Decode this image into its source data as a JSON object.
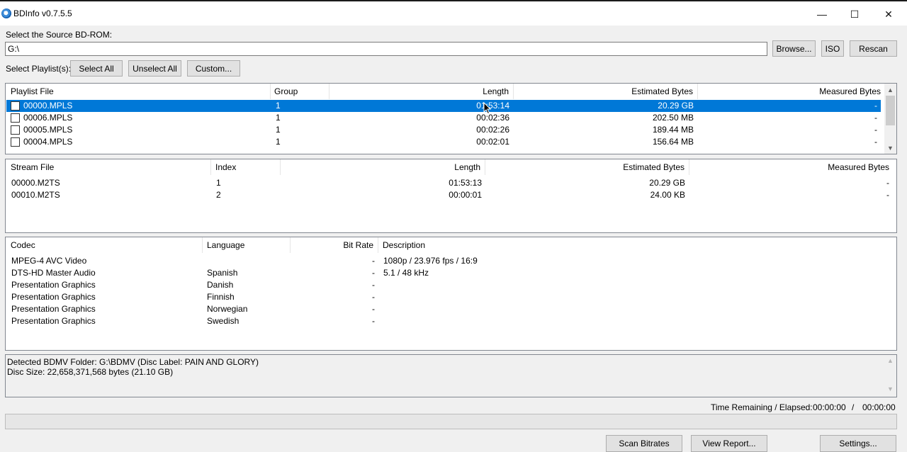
{
  "window": {
    "title": "BDInfo v0.7.5.5",
    "minimize_glyph": "—",
    "maximize_glyph": "☐",
    "close_glyph": "✕"
  },
  "source": {
    "label": "Select the Source BD-ROM:",
    "path": "G:\\",
    "browse_label": "Browse...",
    "iso_label": "ISO",
    "rescan_label": "Rescan"
  },
  "playlist_controls": {
    "label": "Select Playlist(s):",
    "select_all_label": "Select All",
    "unselect_all_label": "Unselect All",
    "custom_label": "Custom..."
  },
  "playlists": {
    "columns": [
      "Playlist File",
      "Group",
      "Length",
      "Estimated Bytes",
      "Measured Bytes"
    ],
    "rows": [
      {
        "file": "00000.MPLS",
        "group": "1",
        "length": "01:53:14",
        "estimated": "20.29 GB",
        "measured": "-"
      },
      {
        "file": "00006.MPLS",
        "group": "1",
        "length": "00:02:36",
        "estimated": "202.50 MB",
        "measured": "-"
      },
      {
        "file": "00005.MPLS",
        "group": "1",
        "length": "00:02:26",
        "estimated": "189.44 MB",
        "measured": "-"
      },
      {
        "file": "00004.MPLS",
        "group": "1",
        "length": "00:02:01",
        "estimated": "156.64 MB",
        "measured": "-"
      }
    ],
    "selected_index": 0
  },
  "streams": {
    "columns": [
      "Stream File",
      "Index",
      "Length",
      "Estimated Bytes",
      "Measured Bytes"
    ],
    "rows": [
      {
        "file": "00000.M2TS",
        "index": "1",
        "length": "01:53:13",
        "estimated": "20.29 GB",
        "measured": "-"
      },
      {
        "file": "00010.M2TS",
        "index": "2",
        "length": "00:00:01",
        "estimated": "24.00 KB",
        "measured": "-"
      }
    ]
  },
  "codecs": {
    "columns": [
      "Codec",
      "Language",
      "Bit Rate",
      "Description"
    ],
    "rows": [
      {
        "codec": "MPEG-4 AVC Video",
        "language": "",
        "bitrate": "-",
        "description": "1080p / 23.976 fps / 16:9"
      },
      {
        "codec": "DTS-HD Master Audio",
        "language": "Spanish",
        "bitrate": "-",
        "description": "5.1 / 48 kHz"
      },
      {
        "codec": "Presentation Graphics",
        "language": "Danish",
        "bitrate": "-",
        "description": ""
      },
      {
        "codec": "Presentation Graphics",
        "language": "Finnish",
        "bitrate": "-",
        "description": ""
      },
      {
        "codec": "Presentation Graphics",
        "language": "Norwegian",
        "bitrate": "-",
        "description": ""
      },
      {
        "codec": "Presentation Graphics",
        "language": "Swedish",
        "bitrate": "-",
        "description": ""
      }
    ]
  },
  "info": {
    "line1": "Detected BDMV Folder: G:\\BDMV (Disc Label: PAIN AND GLORY)",
    "line2": "Disc Size: 22,658,371,568 bytes (21.10 GB)"
  },
  "status": {
    "time_label": "Time Remaining / Elapsed:",
    "remaining": "00:00:00",
    "separator": "/",
    "elapsed": "00:00:00",
    "progress_percent": 0
  },
  "bottom_buttons": {
    "scan_label": "Scan Bitrates",
    "report_label": "View Report...",
    "settings_label": "Settings..."
  },
  "icons": {
    "scroll_up": "▲",
    "scroll_down": "▼"
  }
}
